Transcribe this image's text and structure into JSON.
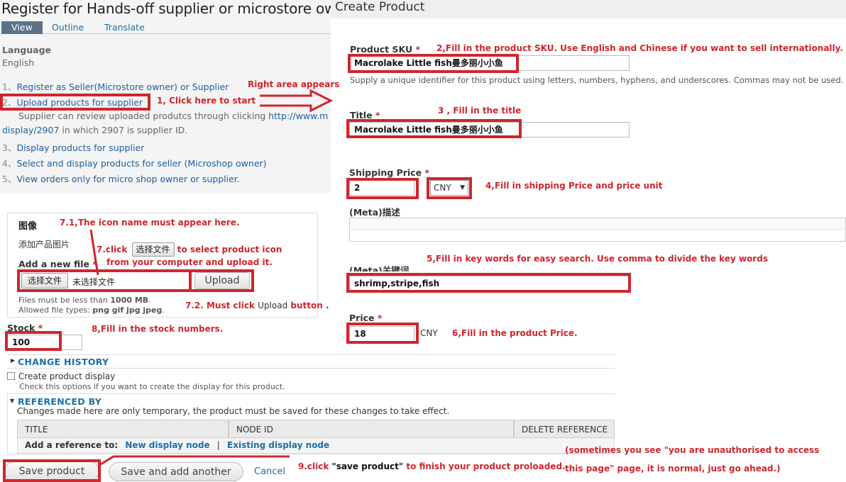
{
  "left": {
    "title": "Register for Hands-off supplier or microstore owner",
    "tabs": {
      "view": "View",
      "outline": "Outline",
      "translate": "Translate"
    },
    "language_label": "Language",
    "language_value": "English",
    "nav_items": [
      {
        "num": "1、",
        "label": "Register as Seller(Microstore owner) or Supplier"
      },
      {
        "num": "2、",
        "label": "Upload products for supplier"
      },
      {
        "num": "3、",
        "label": "Display products for supplier"
      },
      {
        "num": "4、",
        "label": "Select and display products for seller (Microshop owner)"
      },
      {
        "num": "5、",
        "label": "View orders only for micro shop owner or supplier."
      }
    ],
    "supplier_note_1": "Supplier can review uploaded produtcs through clicking ",
    "supplier_note_url": "http://www.m",
    "supplier_note_url_cont": "display/2907",
    "supplier_note_2": " in which 2907 is supplier ID."
  },
  "right": {
    "title": "Create Product",
    "sku": {
      "label": "Product SKU",
      "value": "Macrolake Little fish曼多丽小小鱼",
      "description": "Supply a unique identifier for this product using letters, numbers, hyphens, and underscores. Commas may not be used."
    },
    "title_field": {
      "label": "Title",
      "value": "Macrolake Little fish曼多丽小小鱼"
    },
    "shipping": {
      "label": "Shipping Price",
      "value": "2",
      "currency": "CNY"
    },
    "meta_desc": {
      "label": "(Meta)描述"
    },
    "meta_keywords": {
      "label": "(Meta)关键词",
      "value": "shrimp,stripe,fish"
    },
    "price": {
      "label": "Price",
      "value": "18",
      "unit": "CNY"
    }
  },
  "form": {
    "image_label": "图像",
    "add_image_label": "添加产品图片",
    "add_new_file": "Add a new file",
    "choose_file": "选择文件",
    "no_file": "未选择文件",
    "upload": "Upload",
    "files_size_pre": "Files must be less than ",
    "files_size_val": "1000 MB",
    "files_size_post": ".",
    "allowed_pre": "Allowed file types: ",
    "allowed_types": "png gif jpg jpeg",
    "allowed_post": ".",
    "stock_label": "Stock",
    "stock_value": "100",
    "change_history": "CHANGE HISTORY",
    "create_display": "Create product display",
    "create_display_desc": "Check this options if you want to create the display for this product.",
    "referenced_by": "REFERENCED BY",
    "ref_note": "Changes made here are only temporary, the product must be saved for these changes to take effect.",
    "table_headers": [
      "TITLE",
      "NODE ID",
      "DELETE REFERENCE"
    ],
    "add_reference_label": "Add a reference to:",
    "new_display_node": "New display node",
    "sep": "|",
    "existing_display_node": "Existing display node",
    "save_product": "Save product",
    "save_add_another": "Save and add another",
    "cancel": "Cancel"
  },
  "annotations": {
    "right_area": "Right area appears",
    "step1": "1, Click here to start",
    "step2": "2,Fill in the product SKU. Use English and Chinese  if you want to sell internationally.",
    "step3": "3 , Fill in the title",
    "step4": "4,Fill in shipping Price and price unit",
    "step5": "5,Fill in key words for easy search. Use comma to divide the key words",
    "step6": "6,Fill in the product Price.",
    "step71": "7.1,The icon name must appear here.",
    "step7_pre": "7.click",
    "step7_btn": "选择文件",
    "step7_post": " to select product icon",
    "step7_line2": "from your computer  and upload it.",
    "step72_pre": "7.2. Must click ",
    "step72_btn": "Upload",
    "step72_post": " button .",
    "step8": "8,Fill in the stock numbers.",
    "step9_pre": "9.click ",
    "step9_q": "\"save product\"",
    "step9_post": " to finish your product proloaded.",
    "note_line1": "(sometimes you see \"you are unauthorised to access",
    "note_line2": "this page\" page, it is normal, just go ahead.)"
  },
  "colors": {
    "annotation_red": "#d0262d",
    "link_blue": "#1d6ea8",
    "tab_active": "#5b7287"
  }
}
